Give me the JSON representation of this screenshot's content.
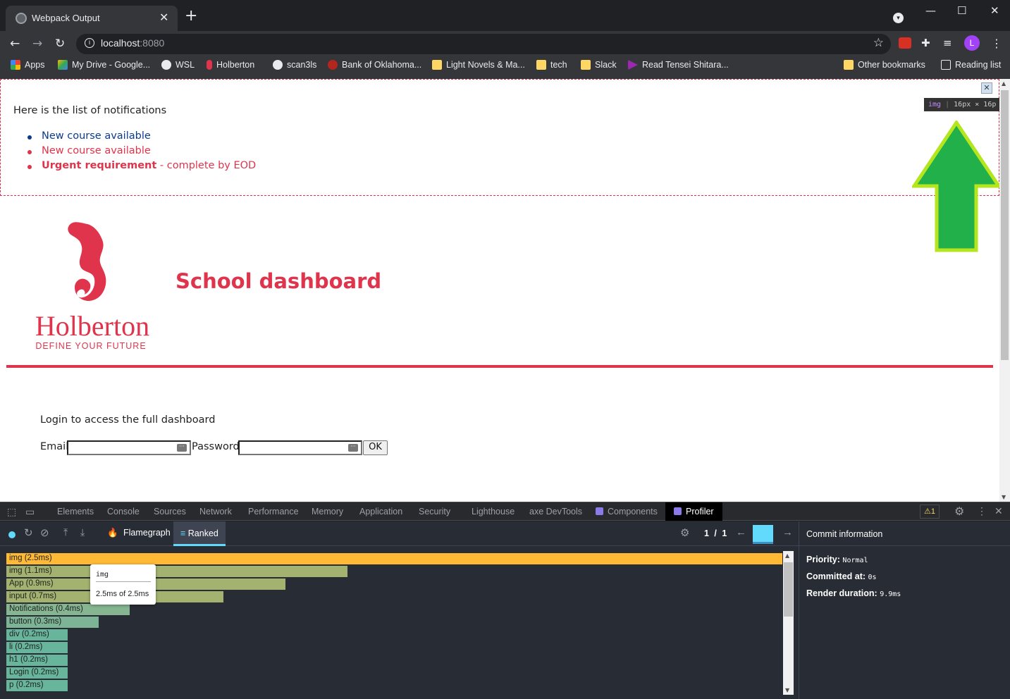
{
  "browser": {
    "tab_title": "Webpack Output",
    "tab_close": "✕",
    "new_tab": "+",
    "url_host": "localhost",
    "url_port": ":8080",
    "profile_initial": "L",
    "window_controls": {
      "minimize": "—",
      "maximize": "☐",
      "close": "✕"
    }
  },
  "bookmarks": [
    {
      "label": "Apps",
      "icon": "apps-grid-icon"
    },
    {
      "label": "My Drive - Google...",
      "icon": "google-drive-icon"
    },
    {
      "label": "WSL",
      "icon": "wsl-icon"
    },
    {
      "label": "Holberton",
      "icon": "holberton-icon"
    },
    {
      "label": "scan3ls",
      "icon": "github-icon"
    },
    {
      "label": "Bank of Oklahoma...",
      "icon": "bank-icon"
    },
    {
      "label": "Light Novels & Ma...",
      "icon": "folder-icon"
    },
    {
      "label": "tech",
      "icon": "folder-icon"
    },
    {
      "label": "Slack",
      "icon": "folder-icon"
    },
    {
      "label": "Read Tensei Shitara...",
      "icon": "site-icon"
    },
    {
      "label": "Other bookmarks",
      "icon": "folder-icon"
    },
    {
      "label": "Reading list",
      "icon": "reading-list-icon"
    }
  ],
  "page": {
    "notifications_title": "Here is the list of notifications",
    "notifications": [
      {
        "type": "default",
        "text": "New course available"
      },
      {
        "type": "urgent",
        "text": "New course available"
      },
      {
        "type": "urgent",
        "bold": "Urgent requirement",
        "rest": " - complete by EOD"
      }
    ],
    "inspect_tip": {
      "tag": "img",
      "size": "16px × 16p"
    },
    "logo_name": "Holberton",
    "logo_tagline": "DEFINE YOUR FUTURE",
    "header_title": "School dashboard",
    "login_message": "Login to access the full dashboard",
    "email_label": "Email",
    "password_label": "Password",
    "ok_label": "OK",
    "email_value": "",
    "password_value": ""
  },
  "devtools": {
    "tabs": [
      "Elements",
      "Console",
      "Sources",
      "Network",
      "Performance",
      "Memory",
      "Application",
      "Security",
      "Lighthouse",
      "axe DevTools",
      "Components",
      "Profiler"
    ],
    "active_tab": "Profiler",
    "warnings": "1",
    "profiler": {
      "views": {
        "flamegraph": "Flamegraph",
        "ranked": "Ranked"
      },
      "pager": "1 / 1",
      "commit_info_title": "Commit information",
      "priority_label": "Priority:",
      "priority_value": "Normal",
      "committed_label": "Committed at:",
      "committed_value": "0s",
      "render_label": "Render duration:",
      "render_value": "9.9ms",
      "tooltip_name": "img",
      "tooltip_value": "2.5ms of 2.5ms"
    }
  },
  "chart_data": {
    "type": "bar",
    "title": "",
    "categories": [
      "img",
      "img",
      "App",
      "input",
      "Notifications",
      "button",
      "div",
      "li",
      "h1",
      "Login",
      "p"
    ],
    "labels": [
      "img (2.5ms)",
      "img (1.1ms)",
      "App (0.9ms)",
      "input (0.7ms)",
      "Notifications (0.4ms)",
      "button (0.3ms)",
      "div (0.2ms)",
      "li (0.2ms)",
      "h1 (0.2ms)",
      "Login (0.2ms)",
      "p (0.2ms)"
    ],
    "values": [
      2.5,
      1.1,
      0.9,
      0.7,
      0.4,
      0.3,
      0.2,
      0.2,
      0.2,
      0.2,
      0.2
    ],
    "colors": [
      "#ffb935",
      "#a3b36f",
      "#a3b36f",
      "#a3b36f",
      "#86b591",
      "#7db496",
      "#67b59b",
      "#67b59b",
      "#67b59b",
      "#67b59b",
      "#67b59b"
    ],
    "xlim": [
      0,
      2.5
    ],
    "units": "ms"
  },
  "colors": {
    "accent_red": "#e0344c",
    "react_blue": "#61dafb",
    "arrow_green": "#22b04a",
    "arrow_outline": "#b5e61d"
  }
}
